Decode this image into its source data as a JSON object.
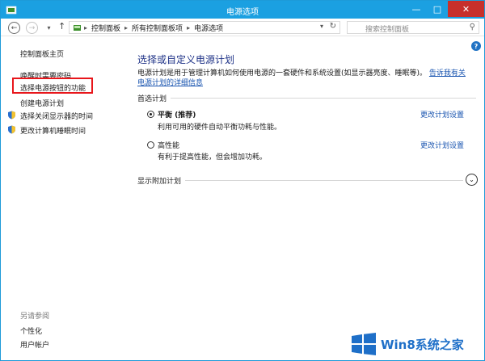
{
  "window": {
    "title": "电源选项"
  },
  "address": {
    "crumbs": [
      "控制面板",
      "所有控制面板项",
      "电源选项"
    ],
    "search_placeholder": "搜索控制面板"
  },
  "sidebar": {
    "home": "控制面板主页",
    "items": [
      {
        "label": "唤醒时需要密码",
        "icon": ""
      },
      {
        "label": "选择电源按钮的功能",
        "icon": "",
        "highlighted": true
      },
      {
        "label": "创建电源计划",
        "icon": ""
      },
      {
        "label": "选择关闭显示器的时间",
        "icon": "shield-icon"
      },
      {
        "label": "更改计算机睡眠时间",
        "icon": "shield-icon"
      }
    ],
    "see_also_title": "另请参阅",
    "see_also": [
      "个性化",
      "用户帐户"
    ]
  },
  "main": {
    "title": "选择或自定义电源计划",
    "description": "电源计划是用于管理计算机如何使用电源的一套硬件和系统设置(如显示器亮度、睡眠等)。",
    "description_link": "告诉我有关电源计划的详细信息",
    "preferred_label": "首选计划",
    "plans": [
      {
        "name": "平衡 (推荐)",
        "selected": true,
        "description": "利用可用的硬件自动平衡功耗与性能。",
        "change_link": "更改计划设置"
      },
      {
        "name": "高性能",
        "selected": false,
        "description": "有利于提高性能，但会增加功耗。",
        "change_link": "更改计划设置"
      }
    ],
    "additional_label": "显示附加计划"
  },
  "watermark": {
    "text": "Win8系统之家"
  },
  "colors": {
    "titlebar": "#1ba0e1",
    "highlight": "#e8161b",
    "link": "#1a55b0",
    "heading": "#1e3287"
  }
}
